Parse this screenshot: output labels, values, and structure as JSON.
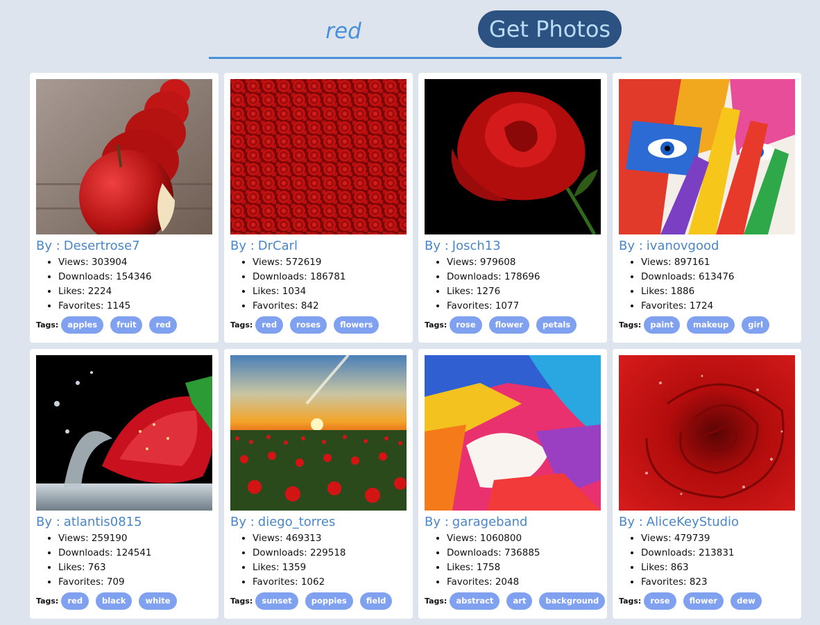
{
  "search": {
    "value": "red",
    "button_label": "Get Photos"
  },
  "labels": {
    "by": "By :",
    "views": "Views:",
    "downloads": "Downloads:",
    "likes": "Likes:",
    "favorites": "Favorites:",
    "tags": "Tags:"
  },
  "colors": {
    "page_bg": "#dde4ee",
    "accent": "#4a90d9",
    "button_bg": "#2c5282",
    "tag_bg": "#7fa1ef"
  },
  "photos": [
    {
      "author": "Desertrose7",
      "views": "303904",
      "downloads": "154346",
      "likes": "2224",
      "favorites": "1145",
      "tags": [
        "apples",
        "fruit",
        "red"
      ],
      "image": "red-apples"
    },
    {
      "author": "DrCarl",
      "views": "572619",
      "downloads": "186781",
      "likes": "1034",
      "favorites": "842",
      "tags": [
        "red",
        "roses",
        "flowers"
      ],
      "image": "field-of-roses"
    },
    {
      "author": "Josch13",
      "views": "979608",
      "downloads": "178696",
      "likes": "1276",
      "favorites": "1077",
      "tags": [
        "rose",
        "flower",
        "petals"
      ],
      "image": "red-rose-black-bg"
    },
    {
      "author": "ivanovgood",
      "views": "897161",
      "downloads": "613476",
      "likes": "1886",
      "favorites": "1724",
      "tags": [
        "paint",
        "makeup",
        "girl"
      ],
      "image": "painted-face"
    },
    {
      "author": "atlantis0815",
      "views": "259190",
      "downloads": "124541",
      "likes": "763",
      "favorites": "709",
      "tags": [
        "red",
        "black",
        "white"
      ],
      "image": "strawberry-splash"
    },
    {
      "author": "diego_torres",
      "views": "469313",
      "downloads": "229518",
      "likes": "1359",
      "favorites": "1062",
      "tags": [
        "sunset",
        "poppies",
        "field"
      ],
      "image": "poppy-field-sunset"
    },
    {
      "author": "garageband",
      "views": "1060800",
      "downloads": "736885",
      "likes": "1758",
      "favorites": "2048",
      "tags": [
        "abstract",
        "art",
        "background"
      ],
      "image": "abstract-paint"
    },
    {
      "author": "AliceKeyStudio",
      "views": "479739",
      "downloads": "213831",
      "likes": "863",
      "favorites": "823",
      "tags": [
        "rose",
        "flower",
        "dew"
      ],
      "image": "rose-with-dew"
    }
  ]
}
